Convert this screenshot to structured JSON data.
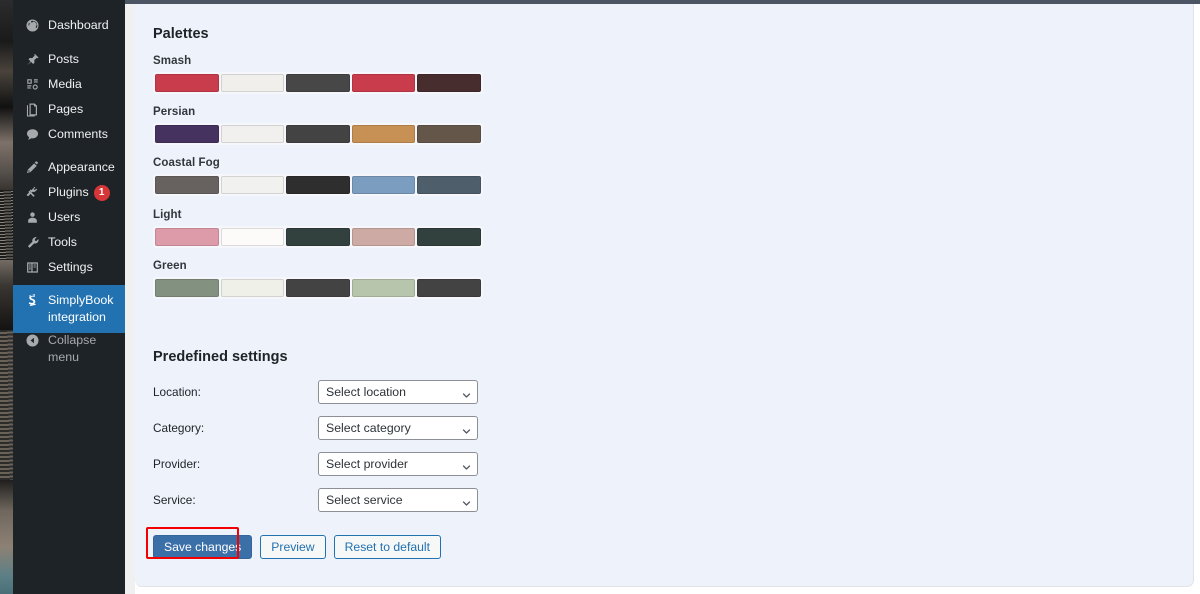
{
  "sidebar": {
    "items": [
      {
        "label": "Dashboard",
        "icon": "dashboard-icon",
        "current": false
      },
      {
        "label": "Posts",
        "icon": "pin-icon",
        "current": false
      },
      {
        "label": "Media",
        "icon": "media-icon",
        "current": false
      },
      {
        "label": "Pages",
        "icon": "pages-icon",
        "current": false
      },
      {
        "label": "Comments",
        "icon": "comments-icon",
        "current": false
      },
      {
        "label": "Appearance",
        "icon": "brush-icon",
        "current": false
      },
      {
        "label": "Plugins",
        "icon": "plugin-icon",
        "current": false,
        "badge": "1"
      },
      {
        "label": "Users",
        "icon": "users-icon",
        "current": false
      },
      {
        "label": "Tools",
        "icon": "wrench-icon",
        "current": false
      },
      {
        "label": "Settings",
        "icon": "settings-icon",
        "current": false
      },
      {
        "label": "SimplyBook integration",
        "icon": "simplybook-icon",
        "current": true
      }
    ],
    "collapse": {
      "label": "Collapse menu",
      "icon": "collapse-arrow-icon"
    }
  },
  "main": {
    "palettes_title": "Palettes",
    "palettes": [
      {
        "name": "Smash",
        "colors": [
          "#c93c4b",
          "#f0efeb",
          "#464746",
          "#c93c4b",
          "#472d2e"
        ]
      },
      {
        "name": "Persian",
        "colors": [
          "#46325e",
          "#f1f0ee",
          "#434343",
          "#c79055",
          "#65564a"
        ]
      },
      {
        "name": "Coastal Fog",
        "colors": [
          "#67625f",
          "#f1f2ef",
          "#2e2e2e",
          "#7b9dc0",
          "#4e5e6b"
        ]
      },
      {
        "name": "Light",
        "colors": [
          "#dd9aa8",
          "#fcfbf9",
          "#32403e",
          "#cdaba4",
          "#32403e"
        ]
      },
      {
        "name": "Green",
        "colors": [
          "#829180",
          "#eff1e9",
          "#434343",
          "#b6c5ab",
          "#434343"
        ]
      }
    ],
    "predefined_title": "Predefined settings",
    "fields": [
      {
        "label": "Location:",
        "value": "Select location",
        "name": "location"
      },
      {
        "label": "Category:",
        "value": "Select category",
        "name": "category"
      },
      {
        "label": "Provider:",
        "value": "Select provider",
        "name": "provider"
      },
      {
        "label": "Service:",
        "value": "Select service",
        "name": "service"
      }
    ],
    "buttons": {
      "save": "Save changes",
      "preview": "Preview",
      "reset": "Reset to default"
    }
  },
  "highlight": {
    "target": "Save changes",
    "color": "#f40000"
  }
}
